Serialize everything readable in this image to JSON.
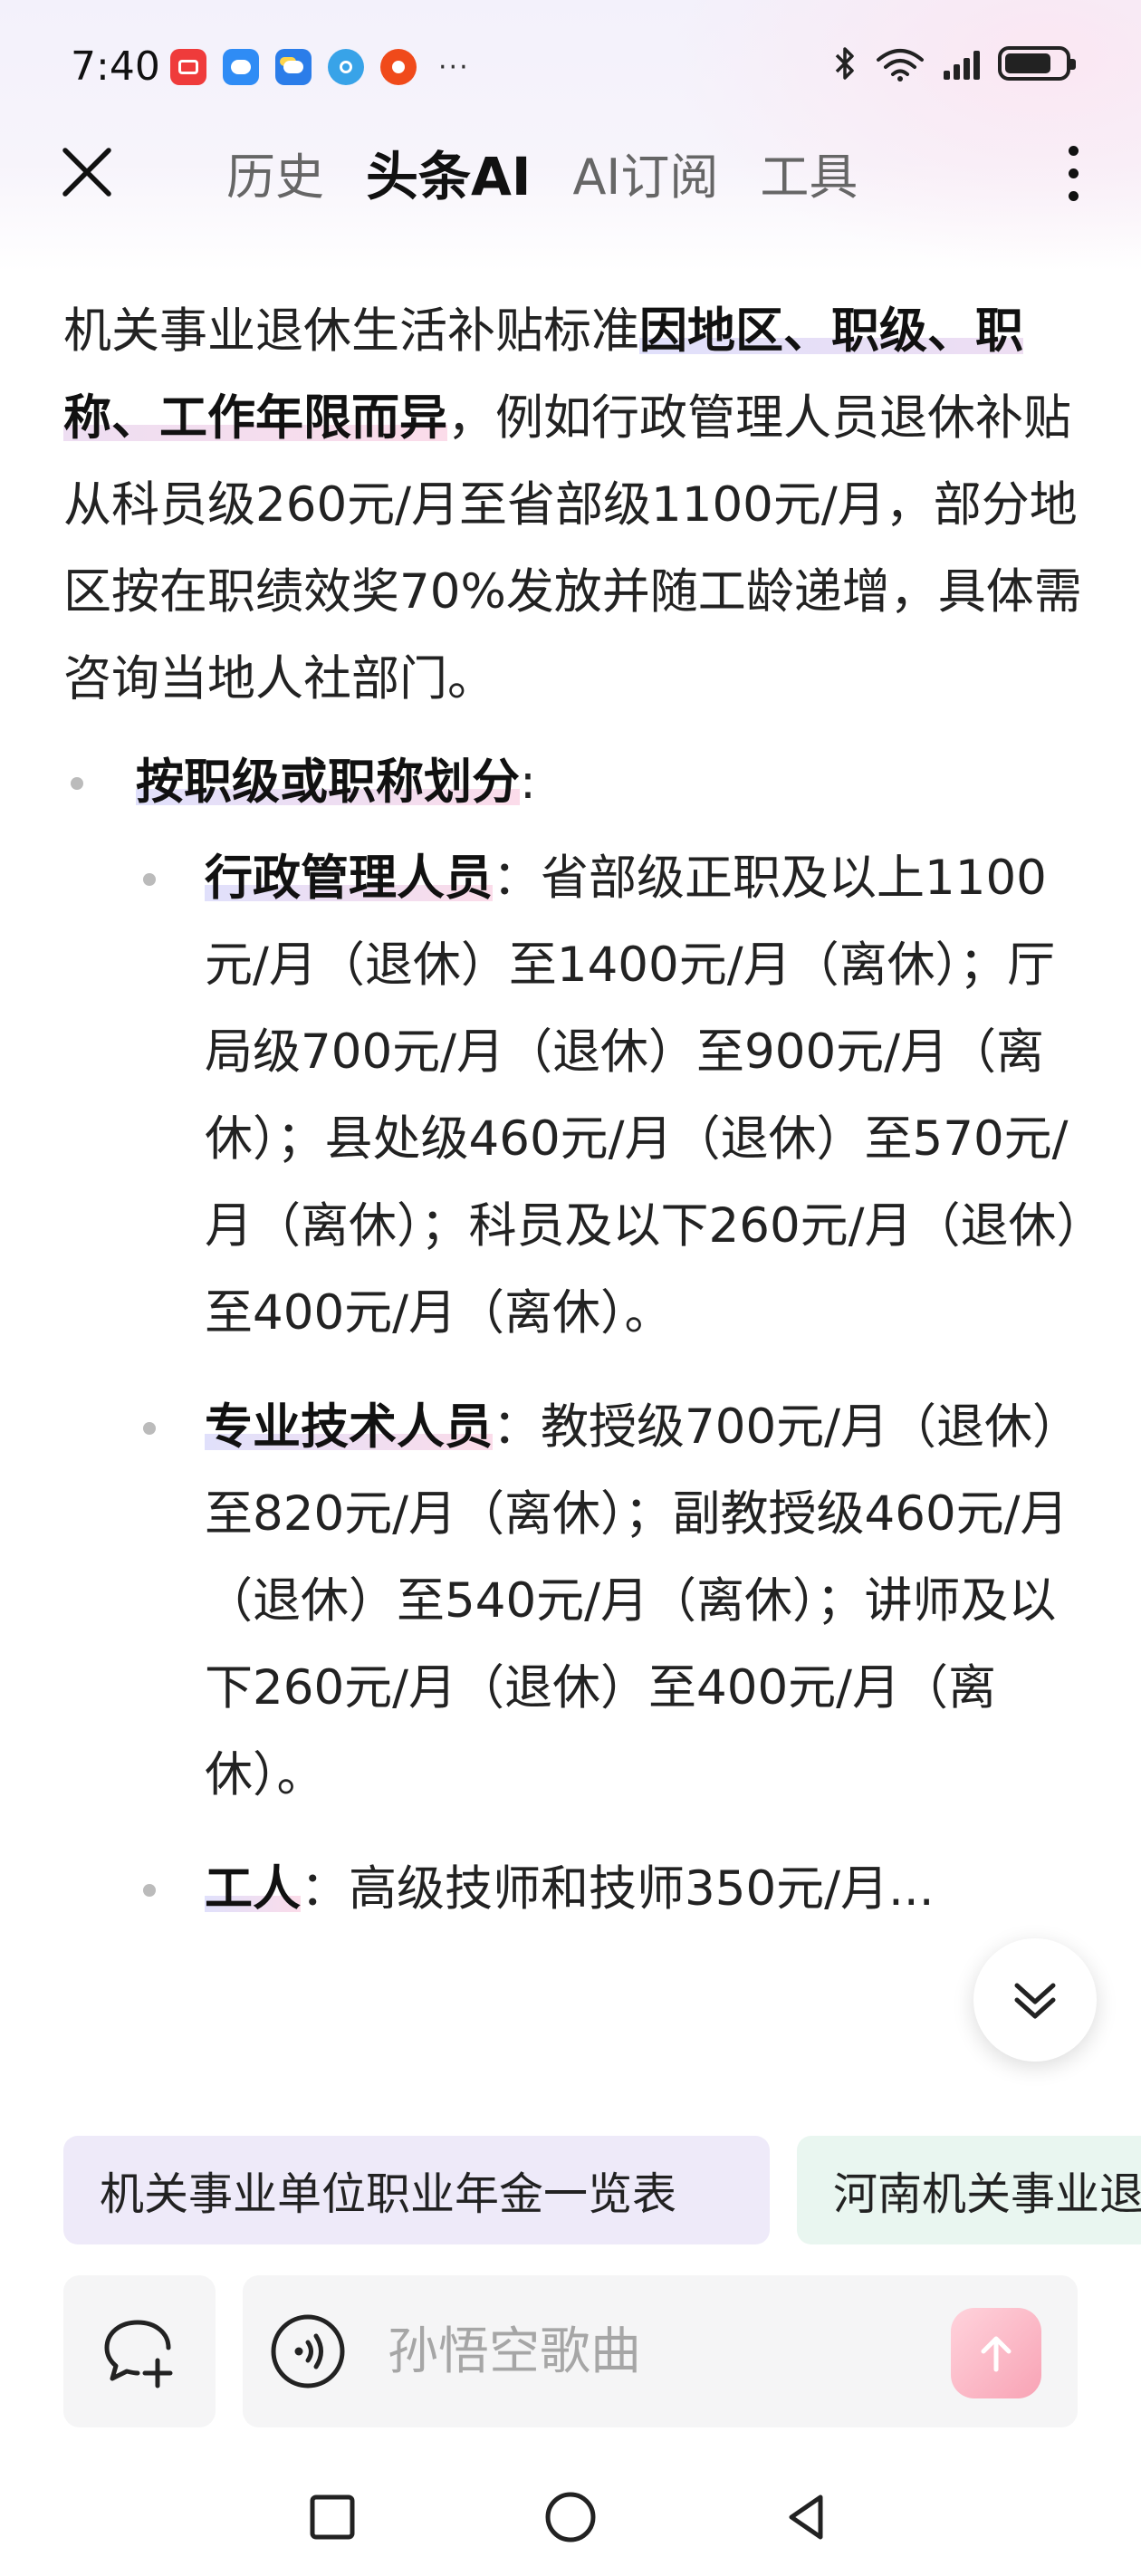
{
  "status_bar": {
    "time": "7:40",
    "more": "···",
    "battery_level": 0.78,
    "app_icons": [
      "screen-record-icon",
      "chat-bubble-icon",
      "weather-icon",
      "browser-icon",
      "toutiao-icon"
    ]
  },
  "header": {
    "tabs": [
      {
        "label": "历史",
        "active": false
      },
      {
        "label": "头条AI",
        "active": true
      },
      {
        "label": "AI订阅",
        "active": false
      },
      {
        "label": "工具",
        "active": false
      }
    ]
  },
  "content": {
    "intro_prefix": "机关事业退休生活补贴标准",
    "intro_highlight": "因地区、职级、职称、工作年限而异",
    "intro_suffix": "，例如行政管理人员退休补贴从科员级260元/月至省部级1100元/月，部分地区按在职绩效奖70%发放并随工龄递增，具体需咨询当地人社部门。",
    "section_title": "按职级或职称划分",
    "section_colon": ":",
    "items": [
      {
        "title": "行政管理人员",
        "text": "：省部级正职及以上1100元/月（退休）至1400元/月（离休）；厅局级700元/月（退休）至900元/月（离休）；县处级460元/月（退休）至570元/月（离休）；科员及以下260元/月（退休）至400元/月（离休）。"
      },
      {
        "title": "专业技术人员",
        "text": "：教授级700元/月（退休）至820元/月（离休）；副教授级460元/月（退休）至540元/月（离休）；讲师及以下260元/月（退休）至400元/月（离休）。"
      },
      {
        "title": "工人",
        "text": "：高级技师和技师350元/月..."
      }
    ]
  },
  "suggestions": [
    "机关事业单位职业年金一览表",
    "河南机关事业退休"
  ],
  "input": {
    "placeholder": "孙悟空歌曲"
  },
  "colors": {
    "accent_pink": "#f8a3b5",
    "chip_purple": "#eeeaf9",
    "chip_green": "#e9f6f0",
    "highlight_blue": "#d6d6fa",
    "highlight_pink": "#fad0e2"
  }
}
